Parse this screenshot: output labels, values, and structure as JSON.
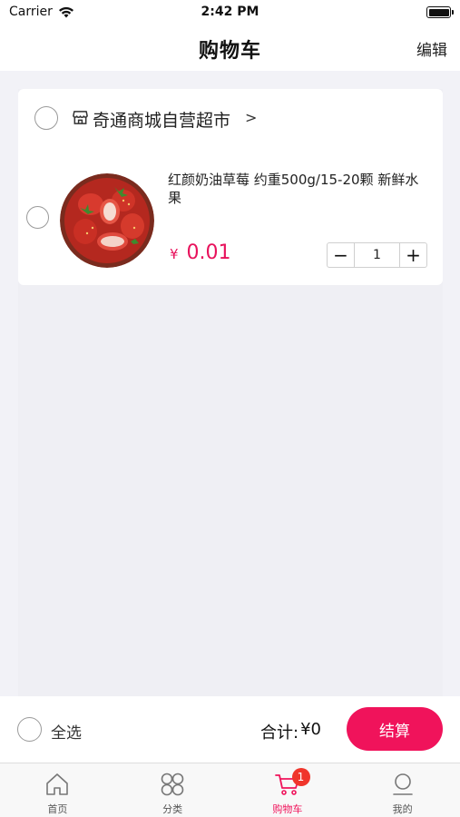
{
  "status_bar": {
    "carrier": "Carrier",
    "time": "2:42 PM"
  },
  "nav": {
    "title": "购物车",
    "edit_label": "编辑"
  },
  "store": {
    "name": "奇通商城自营超市",
    "arrow": ">",
    "items": [
      {
        "title": "红颜奶油草莓 约重500g/15-20颗 新鲜水果",
        "price_symbol": "¥",
        "price": "0.01",
        "quantity": "1",
        "minus_label": "−",
        "plus_label": "+"
      }
    ]
  },
  "checkout": {
    "select_all_label": "全选",
    "total_label": "合计:",
    "total_value": "¥0",
    "button_label": "结算"
  },
  "tabs": [
    {
      "label": "首页",
      "icon": "home-icon",
      "active": false
    },
    {
      "label": "分类",
      "icon": "category-icon",
      "active": false
    },
    {
      "label": "购物车",
      "icon": "cart-icon",
      "active": true,
      "badge": "1"
    },
    {
      "label": "我的",
      "icon": "profile-icon",
      "active": false
    }
  ],
  "colors": {
    "accent": "#f0135b",
    "badge": "#f0352b",
    "background": "#f2f2f7"
  }
}
